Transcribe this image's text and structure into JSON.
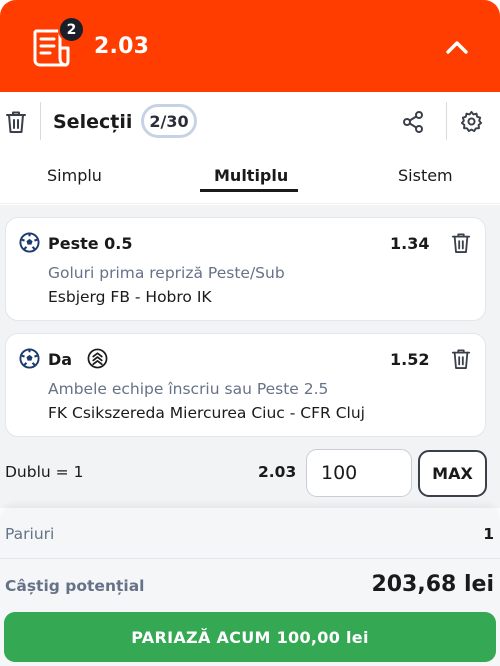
{
  "header": {
    "badge_count": "2",
    "total_odds": "2.03",
    "colors": {
      "background": "#ff3d00",
      "badge": "#1b1f2a"
    },
    "icons": {
      "ticket": "ticket-icon",
      "collapse": "chevron-up-icon"
    }
  },
  "toolbar": {
    "title": "Selecții",
    "count": "2/30",
    "icons": {
      "delete_all": "trash-icon",
      "share": "share-icon",
      "settings": "gear-icon"
    }
  },
  "tabs": [
    {
      "label": "Simplu",
      "active": false
    },
    {
      "label": "Multiplu",
      "active": true
    },
    {
      "label": "Sistem",
      "active": false
    }
  ],
  "selections": [
    {
      "pick": "Peste 0.5",
      "odd": "1.34",
      "market": "Goluri prima repriză Peste/Sub",
      "match": "Esbjerg FB - Hobro IK",
      "sport_icon": "soccer-ball-icon"
    },
    {
      "pick": "Da",
      "odd": "1.52",
      "market": "Ambele echipe înscriu sau Peste 2.5",
      "match": "FK Csikszereda Miercurea Ciuc - CFR Cluj",
      "sport_icon": "soccer-ball-icon",
      "badge_icon": "boost-chevrons-icon"
    }
  ],
  "stake": {
    "combo_label": "Dublu = 1",
    "combo_odds": "2.03",
    "value": "100",
    "max_label": "MAX"
  },
  "summary": {
    "bets_label": "Pariuri",
    "bets_value": "1",
    "win_label": "Câștig potențial",
    "win_value": "203,68 lei",
    "button_label": "PARIAZĂ ACUM 100,00 lei",
    "button_color": "#34a853"
  }
}
